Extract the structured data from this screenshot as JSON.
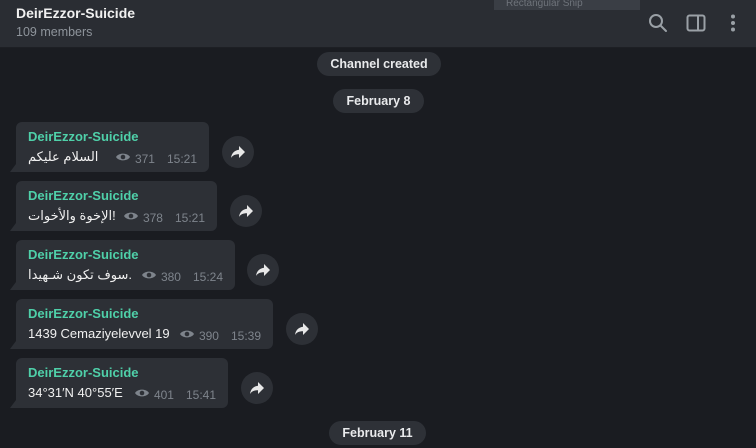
{
  "header": {
    "title": "DeirEzzor-Suicide",
    "subtitle": "109 members",
    "ghost_tab_label": "Rectangular Snip",
    "icons": [
      "search-icon",
      "sidebar-toggle-icon",
      "more-vertical-icon"
    ]
  },
  "services": {
    "channel_created": "Channel created",
    "date1": "February 8",
    "date2": "February 11"
  },
  "messages": [
    {
      "author": "DeirEzzor-Suicide",
      "text": "السلام عليكم",
      "views": "371",
      "time": "15:21"
    },
    {
      "author": "DeirEzzor-Suicide",
      "text": "الإخوة والأخوات!",
      "views": "378",
      "time": "15:21"
    },
    {
      "author": "DeirEzzor-Suicide",
      "text": "سوف تكون شـهيدا.",
      "views": "380",
      "time": "15:24"
    },
    {
      "author": "DeirEzzor-Suicide",
      "text": "1439 Cemaziyelevvel 19",
      "views": "390",
      "time": "15:39"
    },
    {
      "author": "DeirEzzor-Suicide",
      "text": "34°31′N 40°55′E",
      "views": "401",
      "time": "15:41"
    }
  ],
  "colors": {
    "background": "#1a1c21",
    "header": "#2a2d33",
    "bubble": "#2d3036",
    "author": "#4fd0a9",
    "meta": "#7e848c"
  }
}
